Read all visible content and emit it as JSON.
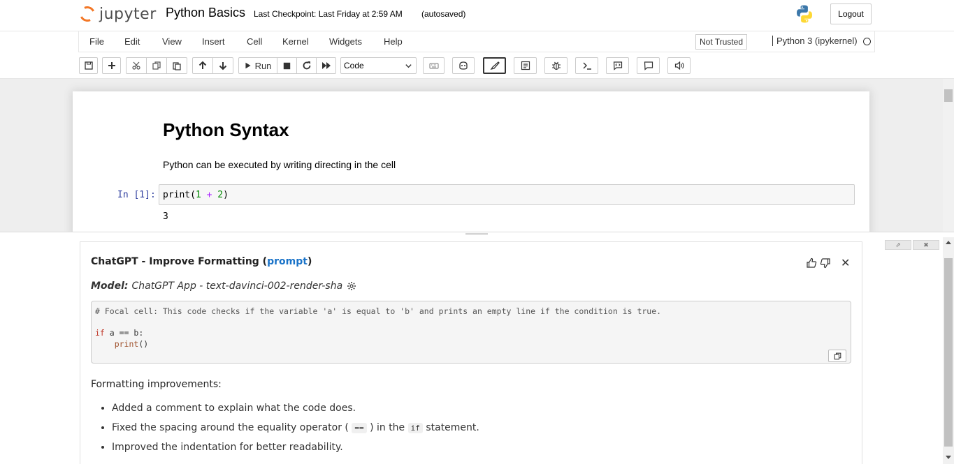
{
  "header": {
    "logo_text": "jupyter",
    "notebook_title": "Python Basics",
    "checkpoint": "Last Checkpoint: Last Friday at 2:59 AM",
    "autosave": "(autosaved)",
    "logout_label": "Logout"
  },
  "menubar": {
    "items": [
      "File",
      "Edit",
      "View",
      "Insert",
      "Cell",
      "Kernel",
      "Widgets",
      "Help"
    ],
    "trust_label": "Not Trusted",
    "kernel_name": "Python 3 (ipykernel)"
  },
  "toolbar": {
    "run_label": "Run",
    "cell_type_value": "Code",
    "icons": [
      "save-icon",
      "plus-icon",
      "cut-icon",
      "copy-icon",
      "paste-icon",
      "arrow-up-icon",
      "arrow-down-icon",
      "play-icon",
      "stop-icon",
      "restart-icon",
      "fast-forward-icon",
      "keyboard-icon",
      "copilot-icon",
      "brush-icon",
      "format-icon",
      "bug-icon",
      "terminal-icon",
      "comment-code-icon",
      "comment-icon",
      "speaker-icon"
    ]
  },
  "notebook": {
    "heading": "Python Syntax",
    "text": "Python can be executed by writing directing in the cell",
    "in_prompt": "In [1]:",
    "code_fn": "print(",
    "code_a": "1",
    "code_op": "+",
    "code_b": "2",
    "code_close": ")",
    "output": "3"
  },
  "gpt_panel": {
    "title_prefix": "ChatGPT - Improve Formatting (",
    "title_link": "prompt",
    "title_suffix": ")",
    "model_label": "Model:",
    "model_value": "ChatGPT App - text-davinci-002-render-sha",
    "code_comment": "# Focal cell: This code checks if the variable 'a' is equal to 'b' and prints an empty line if the condition is true.",
    "code_kw": "if",
    "code_cond": " a == b:",
    "code_fn": "print",
    "code_call": "()",
    "improvements_heading": "Formatting improvements:",
    "improvement_1": "Added a comment to explain what the code does.",
    "improvement_2a": "Fixed the spacing around the equality operator (",
    "improvement_2_code1": "==",
    "improvement_2b": ") in the",
    "improvement_2_code2": "if",
    "improvement_2c": "statement.",
    "improvement_3": "Improved the indentation for better readability."
  },
  "colors": {
    "accent_orange": "#f37726",
    "link_blue": "#1a73c8",
    "prompt_blue": "#303f9f"
  }
}
